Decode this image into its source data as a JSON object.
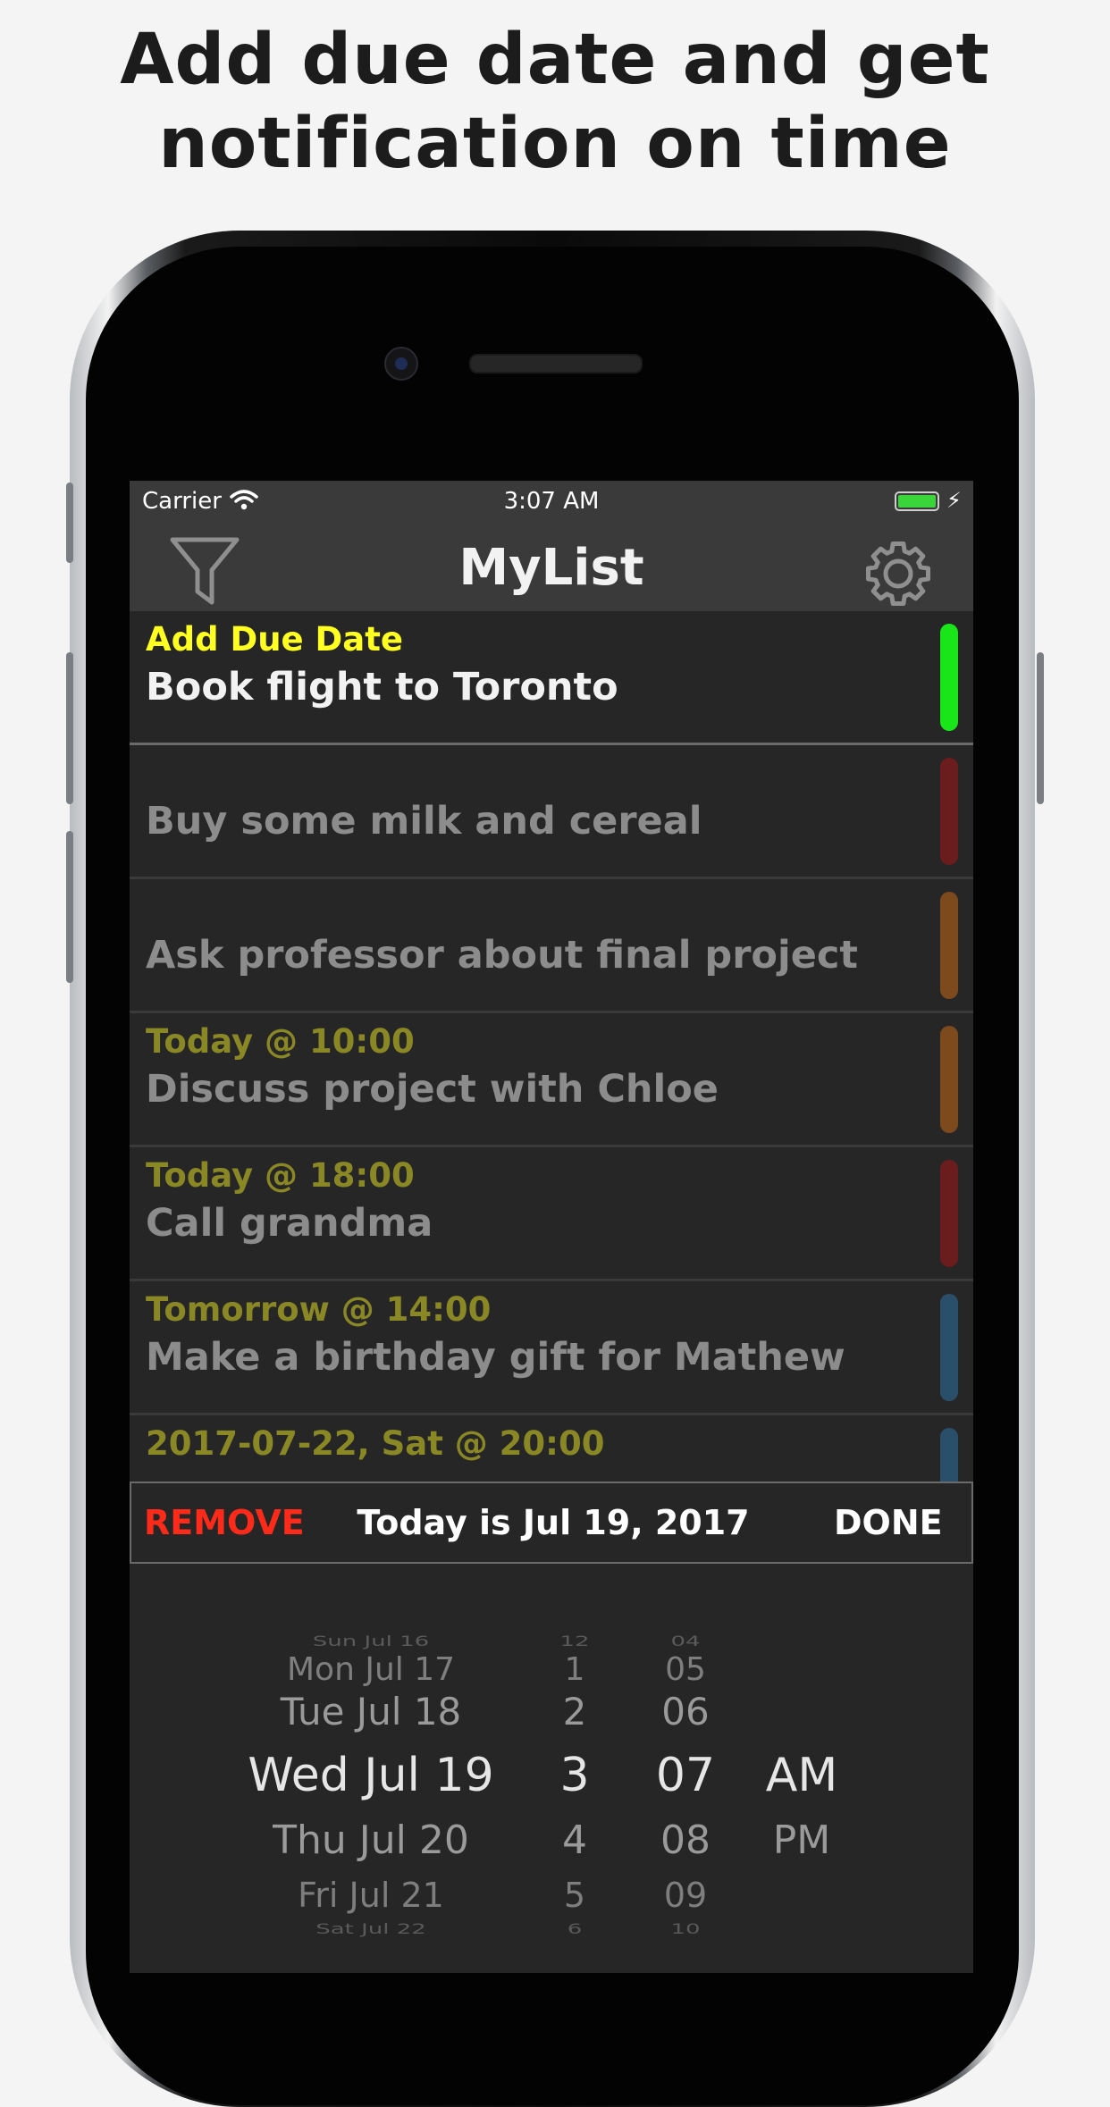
{
  "headline": {
    "line1": "Add due date and get",
    "line2": "notification on time"
  },
  "status_bar": {
    "carrier": "Carrier",
    "time": "3:07 AM",
    "icons": [
      "wifi-icon",
      "battery-icon",
      "charging-bolt-icon"
    ],
    "battery_color": "#3ad53a"
  },
  "nav": {
    "title": "MyList",
    "left_icon": "filter-icon",
    "right_icon": "gear-icon"
  },
  "list": {
    "rows": [
      {
        "due": "Add Due Date",
        "title": "Book flight to Toronto",
        "color": "#19e619"
      },
      {
        "due": "",
        "title": "Buy some milk and cereal",
        "color": "#6b1c1c"
      },
      {
        "due": "",
        "title": "Ask professor about final project",
        "color": "#7d4a1e"
      },
      {
        "due": "Today @ 10:00",
        "title": "Discuss project with Chloe",
        "color": "#7d4a1e"
      },
      {
        "due": "Today @ 18:00",
        "title": "Call grandma",
        "color": "#6b1c1c"
      },
      {
        "due": "Tomorrow @ 14:00",
        "title": "Make a birthday gift for Mathew",
        "color": "#2a4f6b"
      },
      {
        "due": "2017-07-22, Sat @ 20:00",
        "title": "",
        "color": "#2a4f6b"
      }
    ]
  },
  "action_bar": {
    "remove_label": "REMOVE",
    "today_label": "Today is Jul 19, 2017",
    "done_label": "DONE"
  },
  "picker": {
    "dates": [
      "Sun Jul 16",
      "Mon Jul 17",
      "Tue Jul 18",
      "Wed Jul 19",
      "Thu Jul 20",
      "Fri Jul 21",
      "Sat Jul 22"
    ],
    "hours": [
      "12",
      "1",
      "2",
      "3",
      "4",
      "5",
      "6"
    ],
    "minutes": [
      "04",
      "05",
      "06",
      "07",
      "08",
      "09",
      "10"
    ],
    "ampm": [
      "AM",
      "PM"
    ],
    "selected": {
      "date": "Wed Jul 19",
      "hour": "3",
      "minute": "07",
      "ampm": "AM"
    }
  }
}
